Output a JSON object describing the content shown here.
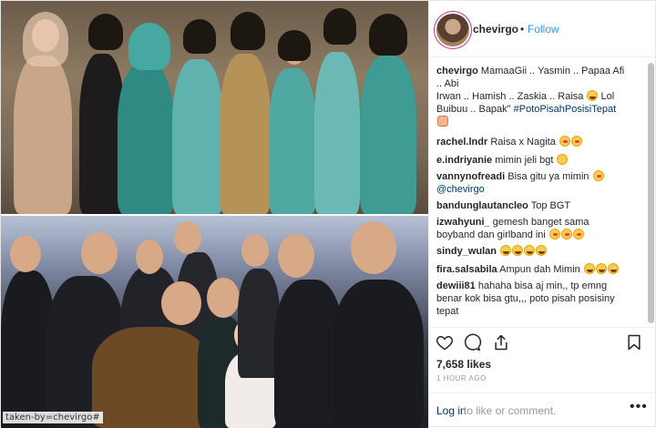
{
  "post": {
    "username": "chevirgo",
    "separator": "•",
    "follow_label": "Follow",
    "watermark": "taken-by=chevirgo#",
    "caption": {
      "user": "chevirgo",
      "line1": "MamaaGii .. Yasmin .. Papaa Afi",
      "line2": ".. Abi",
      "line3": "Irwan .. Hamish .. Zaskia .. Raisa",
      "line4_a": "Lol",
      "line5_a": "Buibuu .. Bapak\"",
      "hashtag": "#PotoPisahPosisiTepat"
    },
    "comments": [
      {
        "user": "rachel.lndr",
        "text": "Raisa x Nagita"
      },
      {
        "user": "e.indriyanie",
        "text": "mimin jeli bgt"
      },
      {
        "user": "vannynofreadi",
        "text": "Bisa gitu ya mimin",
        "mention": "@chevirgo"
      },
      {
        "user": "bandunglautancleo",
        "text": "Top BGT"
      },
      {
        "user": "izwahyuni_",
        "text": "gemesh banget sama",
        "text2": "boyband dan girlband ini"
      },
      {
        "user": "sindy_wulan",
        "text": ""
      },
      {
        "user": "fira.salsabila",
        "text": "Ampun dah Mimin"
      },
      {
        "user": "dewiii81",
        "text": "hahaha bisa aj min,, tp emng",
        "text2": "benar kok bisa gtu,,, poto pisah posisiny",
        "text3": "tepat"
      }
    ],
    "likes": "7,658 likes",
    "time": "1 HOUR AGO",
    "login_label": "Log in",
    "login_rest": "to like or comment.",
    "more_label": "•••"
  },
  "icons": [
    "heart-icon",
    "comment-icon",
    "share-icon",
    "bookmark-icon"
  ],
  "colors": {
    "link": "#3897f0",
    "tag": "#003569",
    "muted": "#999999"
  }
}
